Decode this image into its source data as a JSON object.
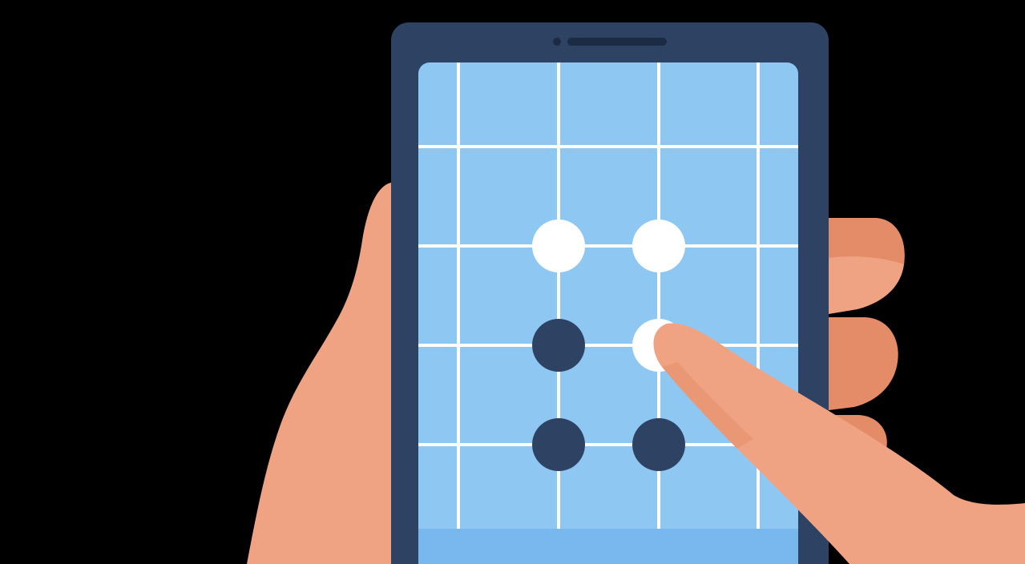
{
  "colors": {
    "background": "#000000",
    "phone_body": "#2e4264",
    "screen": "#8ec8f2",
    "screen_bottom": "#78b8ef",
    "grid_lines": "#ffffff",
    "skin": "#f0a382",
    "skin_shadow": "#e48b68",
    "active_dot": "#ffffff",
    "inactive_dot": "#2e4264"
  },
  "pattern_lock": {
    "rows": 3,
    "columns": 2,
    "dots": [
      {
        "row": 1,
        "col": 1,
        "state": "active"
      },
      {
        "row": 1,
        "col": 2,
        "state": "active"
      },
      {
        "row": 2,
        "col": 1,
        "state": "inactive"
      },
      {
        "row": 2,
        "col": 2,
        "state": "active"
      },
      {
        "row": 3,
        "col": 1,
        "state": "inactive"
      },
      {
        "row": 3,
        "col": 2,
        "state": "inactive"
      }
    ]
  },
  "icons": {
    "speaker": "phone-speaker-icon",
    "camera": "front-camera-icon"
  }
}
